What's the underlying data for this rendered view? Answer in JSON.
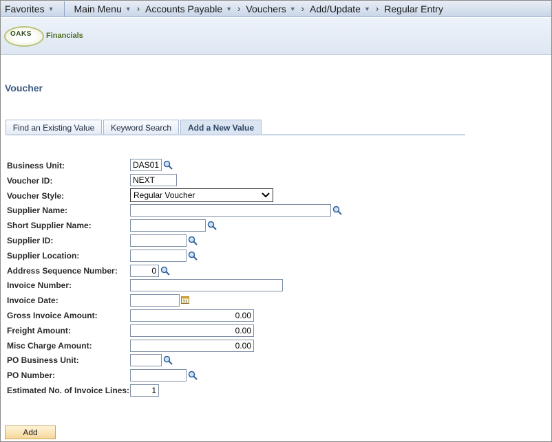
{
  "nav": {
    "favorites": "Favorites",
    "main_menu": "Main Menu",
    "breadcrumbs": [
      "Accounts Payable",
      "Vouchers",
      "Add/Update",
      "Regular Entry"
    ]
  },
  "brand": {
    "logo_text": "OAKS",
    "product": "Financials"
  },
  "page_title": "Voucher",
  "tabs": [
    {
      "label": "Find an Existing Value",
      "accesskey": "F"
    },
    {
      "label": "Keyword Search",
      "accesskey": "K"
    },
    {
      "label": "Add a New Value",
      "active": true
    }
  ],
  "form": {
    "business_unit": {
      "label": "Business Unit:",
      "value": "DAS01"
    },
    "voucher_id": {
      "label": "Voucher ID:",
      "value": "NEXT"
    },
    "voucher_style": {
      "label": "Voucher Style:",
      "value": "Regular Voucher"
    },
    "supplier_name": {
      "label": "Supplier Name:",
      "value": ""
    },
    "short_supplier_name": {
      "label": "Short Supplier Name:",
      "value": ""
    },
    "supplier_id": {
      "label": "Supplier ID:",
      "value": ""
    },
    "supplier_location": {
      "label": "Supplier Location:",
      "value": ""
    },
    "address_seq": {
      "label": "Address Sequence Number:",
      "value": "0"
    },
    "invoice_number": {
      "label": "Invoice Number:",
      "value": ""
    },
    "invoice_date": {
      "label": "Invoice Date:",
      "value": ""
    },
    "gross_invoice_amount": {
      "label": "Gross Invoice Amount:",
      "value": "0.00"
    },
    "freight_amount": {
      "label": "Freight Amount:",
      "value": "0.00"
    },
    "misc_charge_amount": {
      "label": "Misc Charge Amount:",
      "value": "0.00"
    },
    "po_business_unit": {
      "label": "PO Business Unit:",
      "value": ""
    },
    "po_number": {
      "label": "PO Number:",
      "value": ""
    },
    "est_invoice_lines": {
      "label": "Estimated No. of Invoice Lines:",
      "value": "1"
    }
  },
  "add_button": "Add",
  "icons": {
    "lookup": "magnifier-lookup-icon",
    "calendar": "calendar-icon",
    "dropdown": "chevron-down-icon"
  },
  "colors": {
    "title": "#3e5a83",
    "nav_bg": "#c9d6e8",
    "button": "#f6d79a"
  }
}
